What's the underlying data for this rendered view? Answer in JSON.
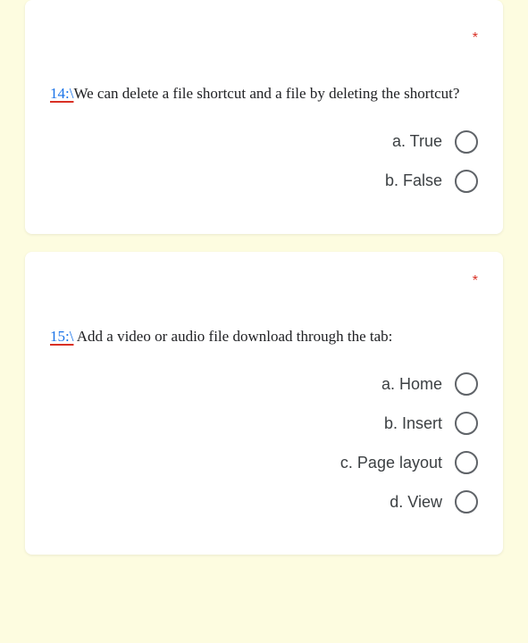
{
  "required_mark": "*",
  "questions": [
    {
      "number": "14:\\",
      "text": "We can delete a file shortcut and a file by deleting the shortcut?",
      "options": [
        {
          "label": "a. True"
        },
        {
          "label": "b. False"
        }
      ]
    },
    {
      "number": "15:\\",
      "text": " Add a video or audio file download through the tab:",
      "options": [
        {
          "label": "a. Home"
        },
        {
          "label": "b. Insert"
        },
        {
          "label": "c. Page layout"
        },
        {
          "label": "d. View"
        }
      ]
    }
  ]
}
